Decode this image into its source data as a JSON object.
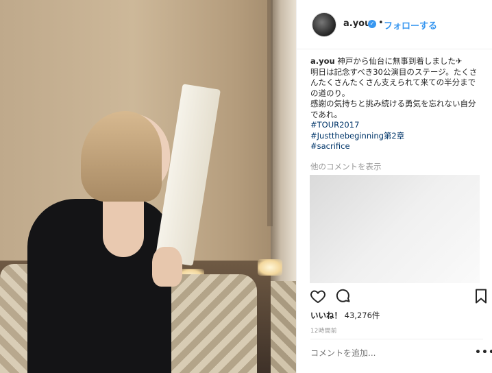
{
  "post": {
    "username": "a.you",
    "dot": "•",
    "follow_label": "フォローする",
    "caption_lines": [
      "神戸から仙台に無事到着しました✈",
      "明日は記念すべき30公演目のステージ。たくさんたくさんたくさん支えられて来ての半分までの道のり。",
      "感謝の気持ちと挑み続ける勇気を忘れない自分であれ。"
    ],
    "hashtags": [
      "#TOUR2017",
      "#Justthebeginning第2章",
      "#sacrifice"
    ],
    "more_comments": "他のコメントを表示",
    "likes_label": "いいね！",
    "likes_count": "43,276件",
    "time_ago": "12時間前",
    "comment_placeholder": "コメントを追加...",
    "more_options": "•••"
  },
  "icons": [
    "heart-icon",
    "comment-icon",
    "bookmark-icon",
    "verified-badge-icon"
  ],
  "colors": {
    "link": "#3897f0",
    "hashtag": "#003569",
    "muted": "#999999"
  }
}
